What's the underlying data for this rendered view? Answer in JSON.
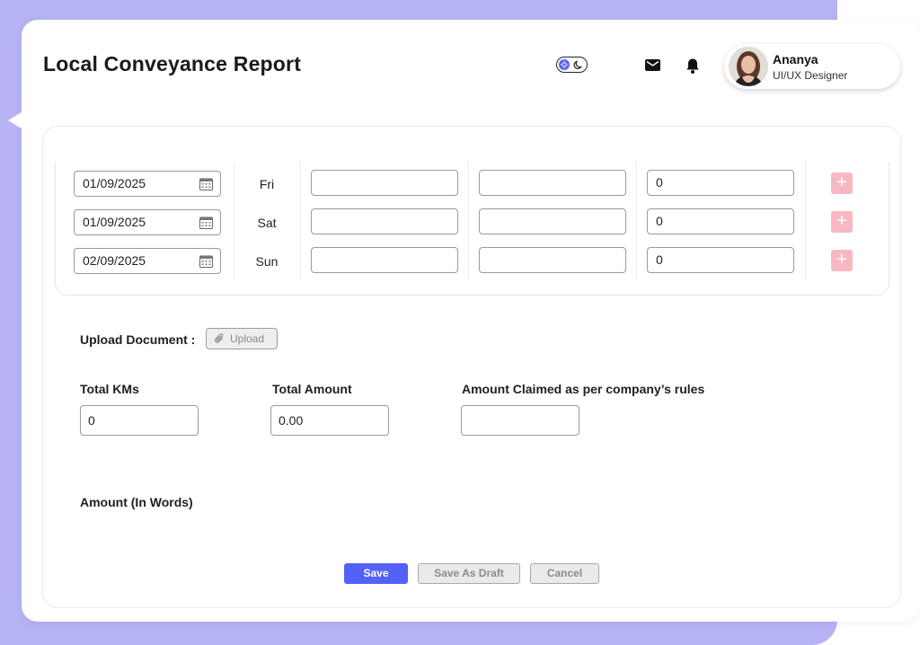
{
  "header": {
    "title": "Local Conveyance Report",
    "profile": {
      "name": "Ananya",
      "role": "UI/UX Designer"
    }
  },
  "rows": [
    {
      "date": "01/09/2025",
      "day": "Fri",
      "field1": "",
      "field2": "",
      "amount": "0"
    },
    {
      "date": "01/09/2025",
      "day": "Sat",
      "field1": "",
      "field2": "",
      "amount": "0"
    },
    {
      "date": "02/09/2025",
      "day": "Sun",
      "field1": "",
      "field2": "",
      "amount": "0"
    }
  ],
  "add_label": "+",
  "upload": {
    "label": "Upload Document :",
    "button": "Upload"
  },
  "totals": {
    "kms_label": "Total KMs",
    "kms_value": "0",
    "amount_label": "Total Amount",
    "amount_value": "0.00",
    "claimed_label": "Amount Claimed as per company’s rules",
    "claimed_value": ""
  },
  "words_label": "Amount (In Words)",
  "actions": {
    "save": "Save",
    "draft": "Save As Draft",
    "cancel": "Cancel"
  },
  "colors": {
    "background_accent": "#b6b3f5",
    "primary": "#5361f7",
    "add_button": "#f8b8c2"
  }
}
